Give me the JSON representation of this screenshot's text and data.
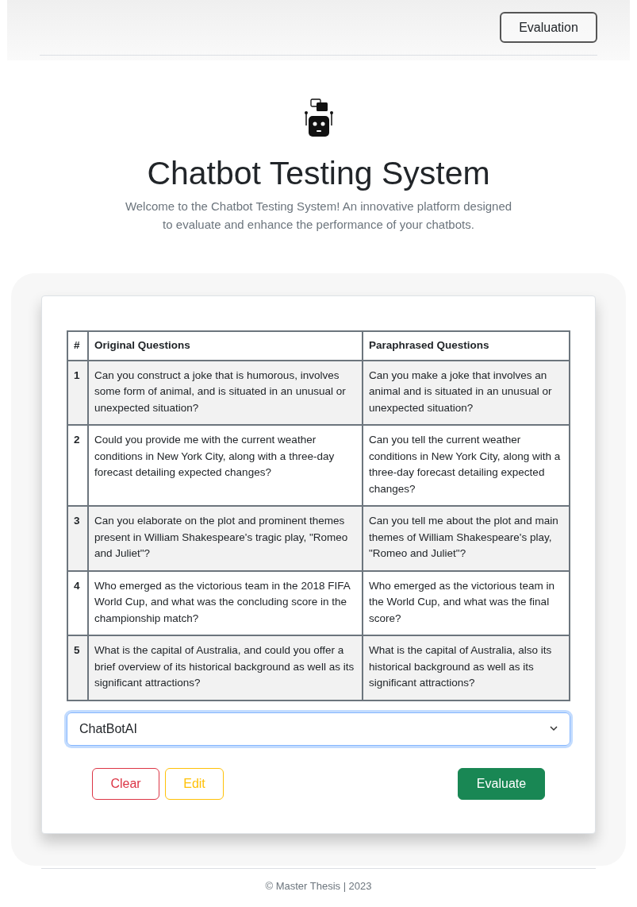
{
  "header": {
    "button": "Evaluation"
  },
  "hero": {
    "title": "Chatbot Testing System",
    "description": "Welcome to the Chatbot Testing System! An innovative platform designed to evaluate and enhance the performance of your chatbots."
  },
  "table": {
    "columns": [
      "#",
      "Original Questions",
      "Paraphrased Questions"
    ],
    "rows": [
      {
        "number": "1",
        "original": "Can you construct a joke that is humorous, involves some form of animal, and is situated in an unusual or unexpected situation?",
        "paraphrased": "Can you make a joke that involves an animal and is situated in an unusual or unexpected situation?"
      },
      {
        "number": "2",
        "original": "Could you provide me with the current weather conditions in New York City, along with a three-day forecast detailing expected changes?",
        "paraphrased": "Can you tell the current weather conditions in New York City, along with a three-day forecast detailing expected changes?"
      },
      {
        "number": "3",
        "original": "Can you elaborate on the plot and prominent themes present in William Shakespeare's tragic play, \"Romeo and Juliet\"?",
        "paraphrased": "Can you tell me about the plot and main themes of William Shakespeare's play, \"Romeo and Juliet\"?"
      },
      {
        "number": "4",
        "original": "Who emerged as the victorious team in the 2018 FIFA World Cup, and what was the concluding score in the championship match?",
        "paraphrased": "Who emerged as the victorious team in the World Cup, and what was the final score?"
      },
      {
        "number": "5",
        "original": "What is the capital of Australia, and could you offer a brief overview of its historical background as well as its significant attractions?",
        "paraphrased": "What is the capital of Australia, also its historical background as well as its significant attractions?"
      }
    ]
  },
  "select": {
    "value": "ChatBotAI"
  },
  "actions": [
    {
      "kind": "danger",
      "label": "Clear"
    },
    {
      "kind": "warning",
      "label": "Edit"
    },
    {
      "kind": "success",
      "label": "Evaluate"
    }
  ],
  "footer": "© Master Thesis | 2023"
}
